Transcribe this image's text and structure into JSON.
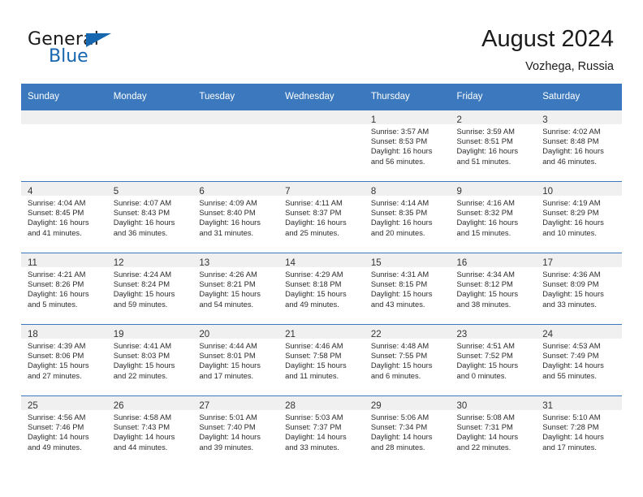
{
  "brand": {
    "word1": "General",
    "word2": "Blue",
    "triangle_color": "#1666b0"
  },
  "title": {
    "month_year": "August 2024",
    "location": "Vozhega, Russia"
  },
  "theme": {
    "header_blue": "#3b78bd",
    "shade_gray": "#f0f0f0"
  },
  "weekday_headers": [
    "Sunday",
    "Monday",
    "Tuesday",
    "Wednesday",
    "Thursday",
    "Friday",
    "Saturday"
  ],
  "weeks": [
    [
      {
        "day": "",
        "lines": []
      },
      {
        "day": "",
        "lines": []
      },
      {
        "day": "",
        "lines": []
      },
      {
        "day": "",
        "lines": []
      },
      {
        "day": "1",
        "lines": [
          "Sunrise: 3:57 AM",
          "Sunset: 8:53 PM",
          "Daylight: 16 hours",
          "and 56 minutes."
        ]
      },
      {
        "day": "2",
        "lines": [
          "Sunrise: 3:59 AM",
          "Sunset: 8:51 PM",
          "Daylight: 16 hours",
          "and 51 minutes."
        ]
      },
      {
        "day": "3",
        "lines": [
          "Sunrise: 4:02 AM",
          "Sunset: 8:48 PM",
          "Daylight: 16 hours",
          "and 46 minutes."
        ]
      }
    ],
    [
      {
        "day": "4",
        "lines": [
          "Sunrise: 4:04 AM",
          "Sunset: 8:45 PM",
          "Daylight: 16 hours",
          "and 41 minutes."
        ]
      },
      {
        "day": "5",
        "lines": [
          "Sunrise: 4:07 AM",
          "Sunset: 8:43 PM",
          "Daylight: 16 hours",
          "and 36 minutes."
        ]
      },
      {
        "day": "6",
        "lines": [
          "Sunrise: 4:09 AM",
          "Sunset: 8:40 PM",
          "Daylight: 16 hours",
          "and 31 minutes."
        ]
      },
      {
        "day": "7",
        "lines": [
          "Sunrise: 4:11 AM",
          "Sunset: 8:37 PM",
          "Daylight: 16 hours",
          "and 25 minutes."
        ]
      },
      {
        "day": "8",
        "lines": [
          "Sunrise: 4:14 AM",
          "Sunset: 8:35 PM",
          "Daylight: 16 hours",
          "and 20 minutes."
        ]
      },
      {
        "day": "9",
        "lines": [
          "Sunrise: 4:16 AM",
          "Sunset: 8:32 PM",
          "Daylight: 16 hours",
          "and 15 minutes."
        ]
      },
      {
        "day": "10",
        "lines": [
          "Sunrise: 4:19 AM",
          "Sunset: 8:29 PM",
          "Daylight: 16 hours",
          "and 10 minutes."
        ]
      }
    ],
    [
      {
        "day": "11",
        "lines": [
          "Sunrise: 4:21 AM",
          "Sunset: 8:26 PM",
          "Daylight: 16 hours",
          "and 5 minutes."
        ]
      },
      {
        "day": "12",
        "lines": [
          "Sunrise: 4:24 AM",
          "Sunset: 8:24 PM",
          "Daylight: 15 hours",
          "and 59 minutes."
        ]
      },
      {
        "day": "13",
        "lines": [
          "Sunrise: 4:26 AM",
          "Sunset: 8:21 PM",
          "Daylight: 15 hours",
          "and 54 minutes."
        ]
      },
      {
        "day": "14",
        "lines": [
          "Sunrise: 4:29 AM",
          "Sunset: 8:18 PM",
          "Daylight: 15 hours",
          "and 49 minutes."
        ]
      },
      {
        "day": "15",
        "lines": [
          "Sunrise: 4:31 AM",
          "Sunset: 8:15 PM",
          "Daylight: 15 hours",
          "and 43 minutes."
        ]
      },
      {
        "day": "16",
        "lines": [
          "Sunrise: 4:34 AM",
          "Sunset: 8:12 PM",
          "Daylight: 15 hours",
          "and 38 minutes."
        ]
      },
      {
        "day": "17",
        "lines": [
          "Sunrise: 4:36 AM",
          "Sunset: 8:09 PM",
          "Daylight: 15 hours",
          "and 33 minutes."
        ]
      }
    ],
    [
      {
        "day": "18",
        "lines": [
          "Sunrise: 4:39 AM",
          "Sunset: 8:06 PM",
          "Daylight: 15 hours",
          "and 27 minutes."
        ]
      },
      {
        "day": "19",
        "lines": [
          "Sunrise: 4:41 AM",
          "Sunset: 8:03 PM",
          "Daylight: 15 hours",
          "and 22 minutes."
        ]
      },
      {
        "day": "20",
        "lines": [
          "Sunrise: 4:44 AM",
          "Sunset: 8:01 PM",
          "Daylight: 15 hours",
          "and 17 minutes."
        ]
      },
      {
        "day": "21",
        "lines": [
          "Sunrise: 4:46 AM",
          "Sunset: 7:58 PM",
          "Daylight: 15 hours",
          "and 11 minutes."
        ]
      },
      {
        "day": "22",
        "lines": [
          "Sunrise: 4:48 AM",
          "Sunset: 7:55 PM",
          "Daylight: 15 hours",
          "and 6 minutes."
        ]
      },
      {
        "day": "23",
        "lines": [
          "Sunrise: 4:51 AM",
          "Sunset: 7:52 PM",
          "Daylight: 15 hours",
          "and 0 minutes."
        ]
      },
      {
        "day": "24",
        "lines": [
          "Sunrise: 4:53 AM",
          "Sunset: 7:49 PM",
          "Daylight: 14 hours",
          "and 55 minutes."
        ]
      }
    ],
    [
      {
        "day": "25",
        "lines": [
          "Sunrise: 4:56 AM",
          "Sunset: 7:46 PM",
          "Daylight: 14 hours",
          "and 49 minutes."
        ]
      },
      {
        "day": "26",
        "lines": [
          "Sunrise: 4:58 AM",
          "Sunset: 7:43 PM",
          "Daylight: 14 hours",
          "and 44 minutes."
        ]
      },
      {
        "day": "27",
        "lines": [
          "Sunrise: 5:01 AM",
          "Sunset: 7:40 PM",
          "Daylight: 14 hours",
          "and 39 minutes."
        ]
      },
      {
        "day": "28",
        "lines": [
          "Sunrise: 5:03 AM",
          "Sunset: 7:37 PM",
          "Daylight: 14 hours",
          "and 33 minutes."
        ]
      },
      {
        "day": "29",
        "lines": [
          "Sunrise: 5:06 AM",
          "Sunset: 7:34 PM",
          "Daylight: 14 hours",
          "and 28 minutes."
        ]
      },
      {
        "day": "30",
        "lines": [
          "Sunrise: 5:08 AM",
          "Sunset: 7:31 PM",
          "Daylight: 14 hours",
          "and 22 minutes."
        ]
      },
      {
        "day": "31",
        "lines": [
          "Sunrise: 5:10 AM",
          "Sunset: 7:28 PM",
          "Daylight: 14 hours",
          "and 17 minutes."
        ]
      }
    ]
  ]
}
